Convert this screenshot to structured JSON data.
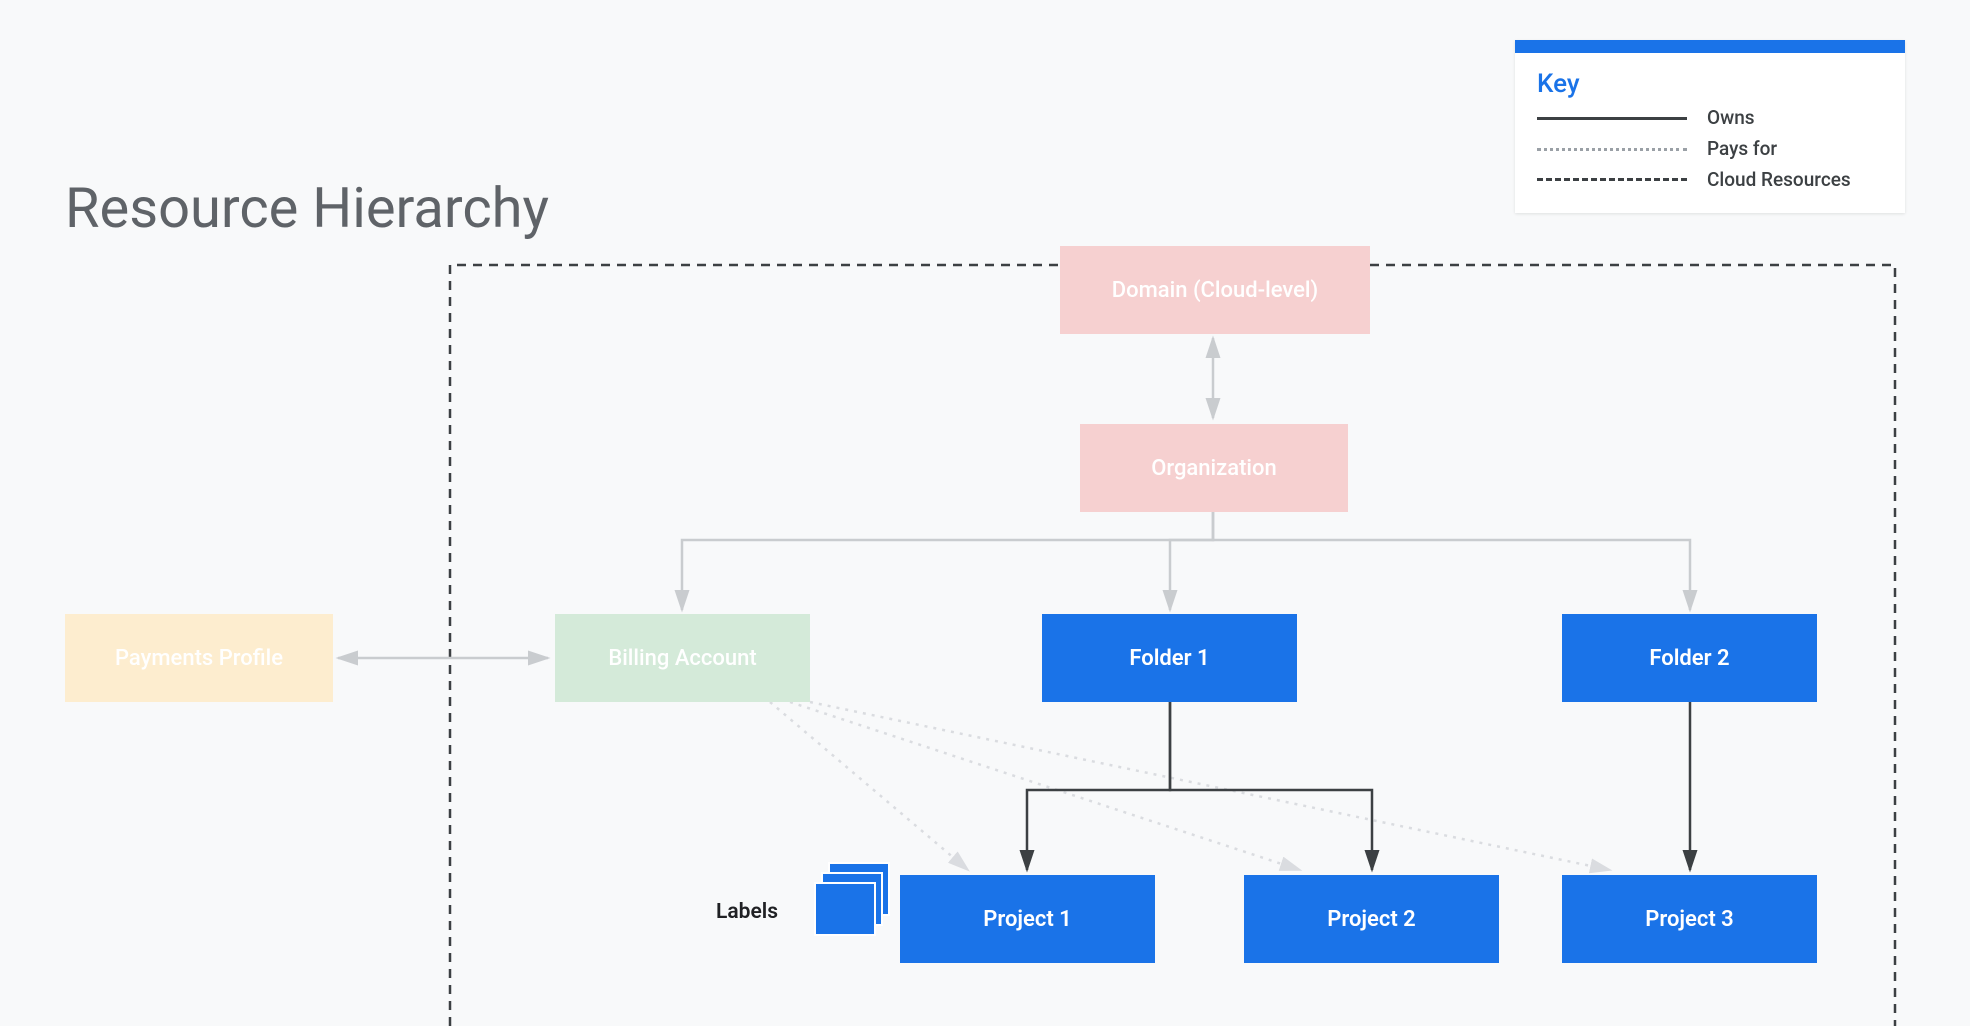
{
  "title": "Resource Hierarchy",
  "legend": {
    "title": "Key",
    "items": [
      {
        "label": "Owns"
      },
      {
        "label": "Pays for"
      },
      {
        "label": "Cloud Resources"
      }
    ]
  },
  "nodes": {
    "domain": "Domain (Cloud-level)",
    "organization": "Organization",
    "payments": "Payments Profile",
    "billing": "Billing Account",
    "folder1": "Folder 1",
    "folder2": "Folder 2",
    "project1": "Project 1",
    "project2": "Project 2",
    "project3": "Project 3"
  },
  "labels_tag": "Labels"
}
